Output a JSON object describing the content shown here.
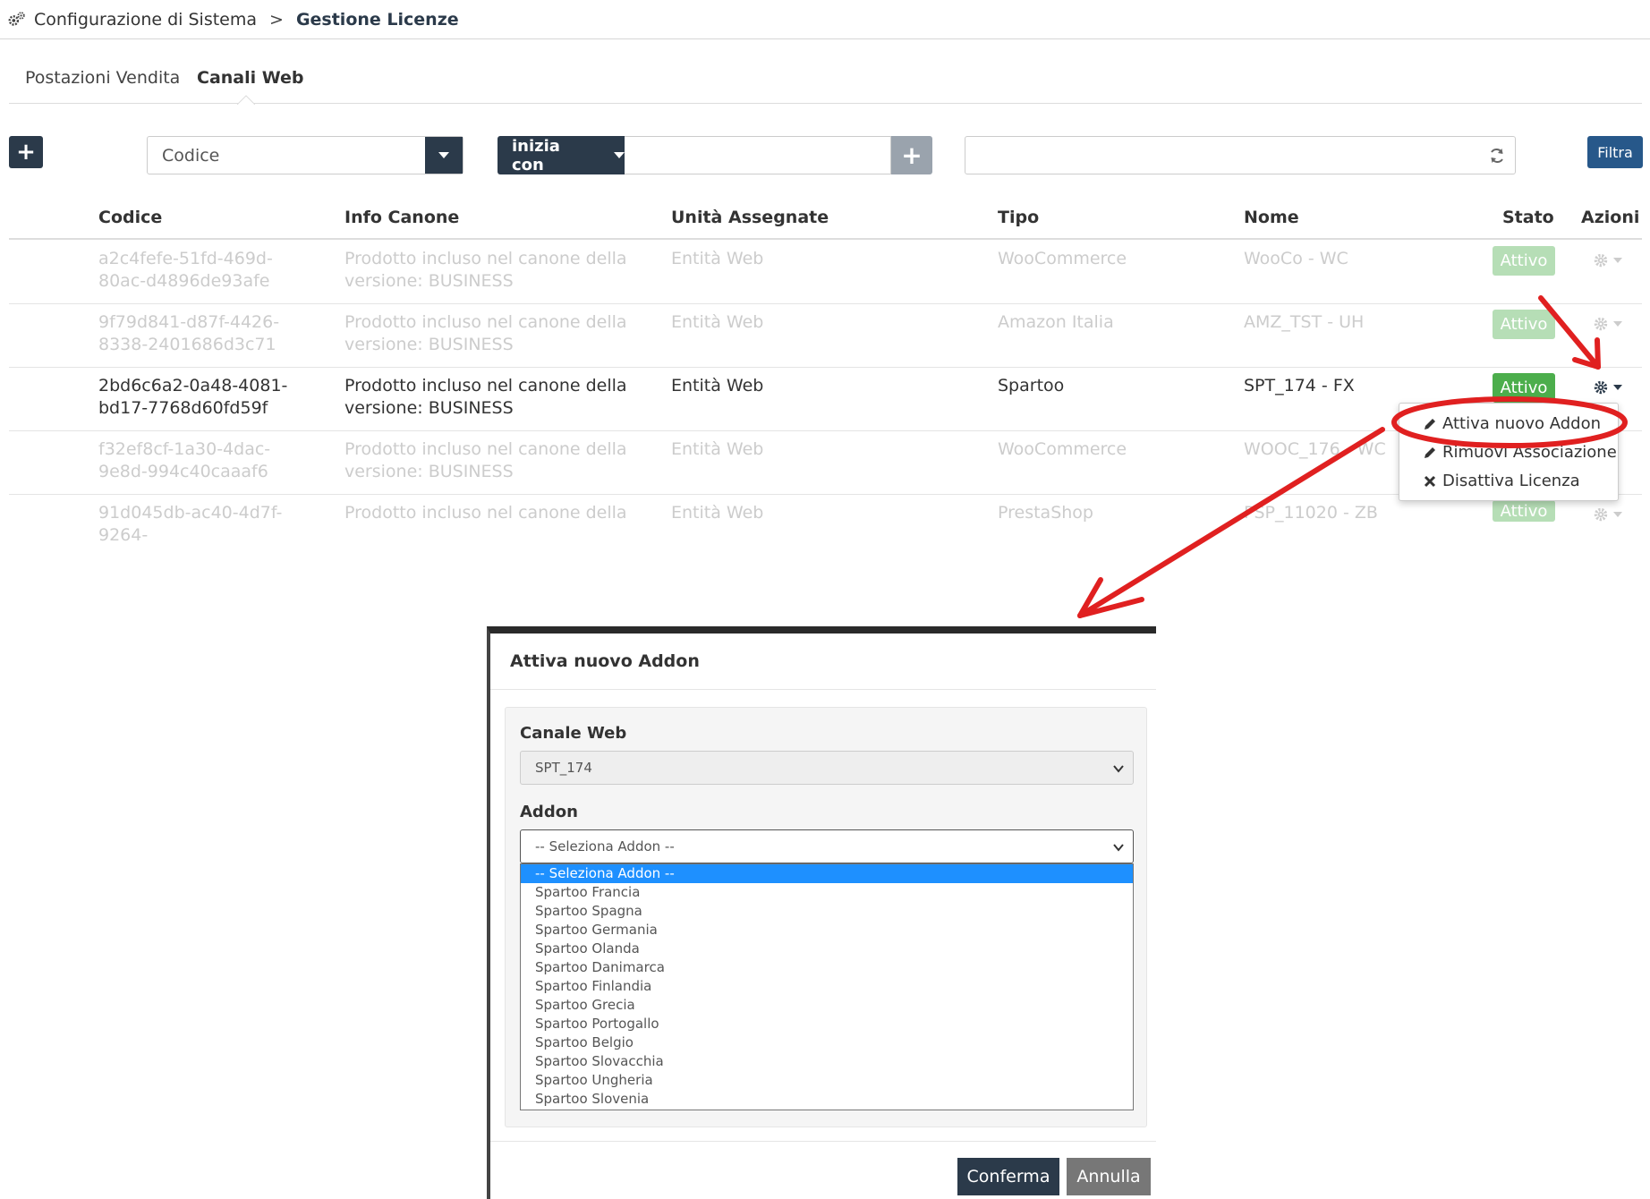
{
  "breadcrumb": {
    "parent": "Configurazione di Sistema",
    "separator": ">",
    "current": "Gestione Licenze"
  },
  "tabs": [
    {
      "label": "Postazioni Vendita"
    },
    {
      "label": "Canali Web",
      "active": true
    }
  ],
  "toolbar": {
    "add_label": "+",
    "field_select": "Codice",
    "operator": "inizia con",
    "value": "",
    "plus_label": "+",
    "search_value": "",
    "filter_label": "Filtra"
  },
  "table": {
    "headers": [
      "Codice",
      "Info Canone",
      "Unità Assegnate",
      "Tipo",
      "Nome",
      "Stato",
      "Azioni"
    ],
    "rows": [
      {
        "code": "a2c4fefe-51fd-469d-80ac-d4896de93afe",
        "info": "Prodotto incluso nel canone della versione:  BUSINESS",
        "unit": "Entità Web",
        "tipo": "WooCommerce",
        "nome": "WooCo - WC",
        "stato": "Attivo"
      },
      {
        "code": "9f79d841-d87f-4426-8338-2401686d3c71",
        "info": "Prodotto incluso nel canone della versione:  BUSINESS",
        "unit": "Entità Web",
        "tipo": "Amazon Italia",
        "nome": "AMZ_TST - UH",
        "stato": "Attivo"
      },
      {
        "code": "2bd6c6a2-0a48-4081-bd17-7768d60fd59f",
        "info": "Prodotto incluso nel canone della versione:  BUSINESS",
        "unit": "Entità Web",
        "tipo": "Spartoo",
        "nome": "SPT_174 - FX",
        "stato": "Attivo"
      },
      {
        "code": "f32ef8cf-1a30-4dac-9e8d-994c40caaaf6",
        "info": "Prodotto incluso nel canone della versione:  BUSINESS",
        "unit": "Entità Web",
        "tipo": "WooCommerce",
        "nome": "WOOC_176 - WC",
        "stato": ""
      },
      {
        "code": "91d045db-ac40-4d7f-9264-",
        "info": "Prodotto incluso nel canone della",
        "unit": "Entità Web",
        "tipo": "PrestaShop",
        "nome": "PSP_11020 - ZB",
        "stato": "Attivo"
      }
    ]
  },
  "actions_menu": {
    "items": [
      {
        "label": "Attiva nuovo Addon",
        "icon": "pencil-icon"
      },
      {
        "label": "Rimuovi Associazione",
        "icon": "pencil-icon"
      },
      {
        "label": "Disattiva Licenza",
        "icon": "times-icon"
      }
    ]
  },
  "modal": {
    "title": "Attiva nuovo Addon",
    "canale_label": "Canale Web",
    "canale_value": "SPT_174",
    "addon_label": "Addon",
    "addon_value": "-- Seleziona Addon --",
    "addon_options": [
      "-- Seleziona Addon --",
      "Spartoo Francia",
      "Spartoo Spagna",
      "Spartoo Germania",
      "Spartoo Olanda",
      "Spartoo Danimarca",
      "Spartoo Finlandia",
      "Spartoo Grecia",
      "Spartoo Portogallo",
      "Spartoo Belgio",
      "Spartoo Slovacchia",
      "Spartoo Ungheria",
      "Spartoo Slovenia"
    ],
    "confirm_label": "Conferma",
    "cancel_label": "Annulla"
  },
  "colors": {
    "primary": "#2b3a4a",
    "accent": "#27588a",
    "success": "#4cae4c",
    "annotation": "#e02020",
    "selected_option": "#1e90ff"
  }
}
